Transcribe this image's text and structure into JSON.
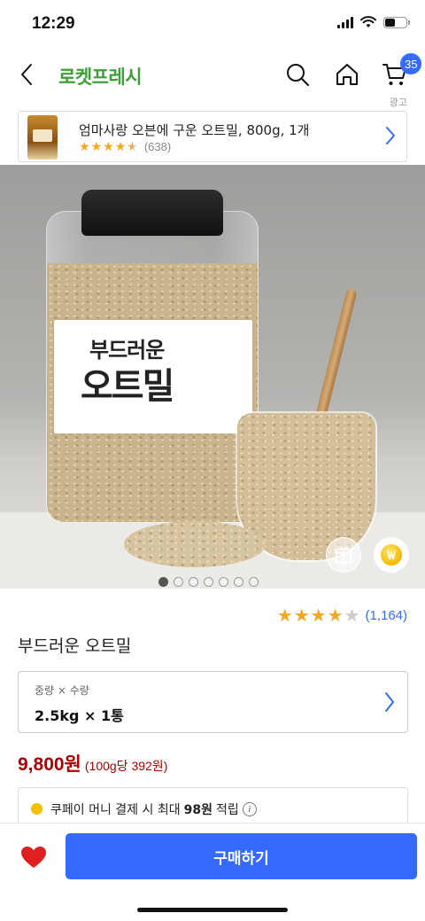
{
  "status_bar": {
    "time": "12:29"
  },
  "header": {
    "brand": "로켓프레시",
    "cart_count": "35",
    "icons": [
      "back-chevron-icon",
      "search-icon",
      "home-icon",
      "cart-icon"
    ]
  },
  "ad": {
    "label": "광고",
    "title": "엄마사랑 오븐에 구운 오트밀, 800g, 1개",
    "rating": 4.5,
    "review_count": "(638)"
  },
  "hero": {
    "label_line1": "부드러운",
    "label_line2": "오트밀",
    "slide_count": 7,
    "active_slide": 0,
    "icons": [
      "gift-icon",
      "coin-icon"
    ]
  },
  "product": {
    "rating": 4,
    "review_count": "(1,164)",
    "title": "부드러운 오트밀",
    "option_label": "중량 × 수량",
    "option_value": "2.5kg × 1통",
    "price": "9,800원",
    "unit_price": "(100g당 392원)",
    "cash_prefix": "쿠페이 머니 결제 시 최대",
    "cash_amount": "98원",
    "cash_suffix": "적립"
  },
  "bottom": {
    "buy_label": "구매하기"
  },
  "colors": {
    "brand_green": "#3e9f38",
    "accent_blue": "#346aff",
    "price_red": "#ae0000",
    "star": "#f5a623",
    "heart": "#e02020"
  }
}
